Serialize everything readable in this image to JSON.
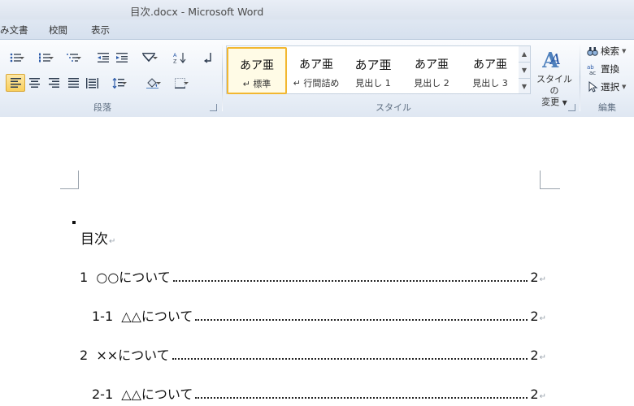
{
  "window": {
    "title": "目次.docx  -  Microsoft Word"
  },
  "tabs": [
    "み文書",
    "校閲",
    "表示"
  ],
  "ribbon": {
    "groups": {
      "paragraph": "段落",
      "styles": "スタイル",
      "editing": "編集"
    },
    "styles": [
      {
        "sample": "あア亜",
        "name": "↵ 標準",
        "selected": true
      },
      {
        "sample": "あア亜",
        "name": "↵ 行間詰め",
        "selected": false
      },
      {
        "sample": "あア亜",
        "name": "見出し 1",
        "selected": false
      },
      {
        "sample": "あア亜",
        "name": "見出し 2",
        "selected": false
      },
      {
        "sample": "あア亜",
        "name": "見出し 3",
        "selected": false
      }
    ],
    "change_styles": {
      "line1": "スタイルの",
      "line2": "変更"
    },
    "editing": {
      "find": "検索",
      "replace": "置換",
      "select": "選択"
    },
    "accent": "#f2b730"
  },
  "document": {
    "title": "目次",
    "paragraph_mark": "↵",
    "toc": [
      {
        "label": "1  ○○について",
        "page": "2"
      },
      {
        "label": "1-1  △△について",
        "page": "2"
      },
      {
        "label": "2  ××について",
        "page": "2"
      },
      {
        "label": "2-1  △△について",
        "page": "2"
      }
    ]
  }
}
